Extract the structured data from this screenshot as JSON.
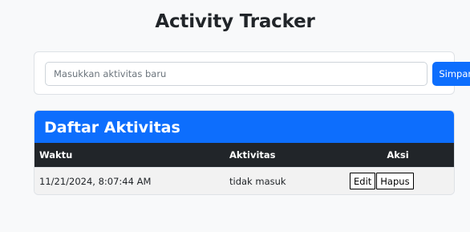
{
  "app": {
    "title": "Activity Tracker"
  },
  "form": {
    "placeholder": "Masukkan aktivitas baru",
    "value": "",
    "save_label": "Simpan"
  },
  "list": {
    "heading": "Daftar Aktivitas",
    "columns": {
      "time": "Waktu",
      "activity": "Aktivitas",
      "actions": "Aksi"
    },
    "rows": [
      {
        "time": "11/21/2024, 8:07:44 AM",
        "activity": "tidak masuk",
        "edit_label": "Edit",
        "delete_label": "Hapus"
      }
    ]
  },
  "colors": {
    "primary": "#0d6efd",
    "table_header": "#212529"
  }
}
